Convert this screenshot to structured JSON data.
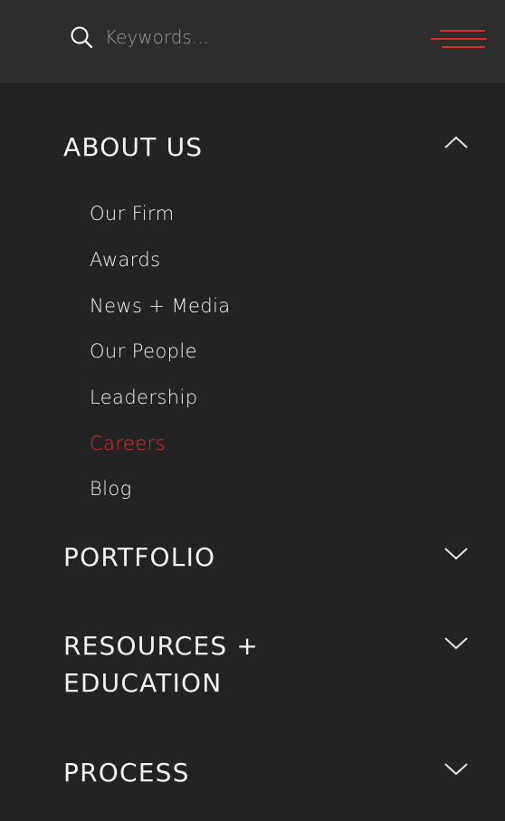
{
  "search": {
    "placeholder": "Keywords...",
    "value": "",
    "icon": "search-icon"
  },
  "menu_toggle": {
    "icon": "hamburger-menu-icon",
    "color": "#d9302b"
  },
  "colors": {
    "background": "#232323",
    "topbar": "#2d2d2d",
    "accent": "#d9302b",
    "text": "#ffffff"
  },
  "nav": {
    "sections": [
      {
        "title": "ABOUT US",
        "expanded": true,
        "chevron_icon": "chevron-up-icon",
        "items": [
          {
            "label": "Our Firm",
            "active": false
          },
          {
            "label": "Awards",
            "active": false
          },
          {
            "label": "News + Media",
            "active": false
          },
          {
            "label": "Our People",
            "active": false
          },
          {
            "label": "Leadership",
            "active": false
          },
          {
            "label": "Careers",
            "active": true
          },
          {
            "label": "Blog",
            "active": false
          }
        ]
      },
      {
        "title": "PORTFOLIO",
        "expanded": false,
        "chevron_icon": "chevron-down-icon"
      },
      {
        "title": "RESOURCES +\nEDUCATION",
        "expanded": false,
        "chevron_icon": "chevron-down-icon"
      },
      {
        "title": "PROCESS",
        "expanded": false,
        "chevron_icon": "chevron-down-icon"
      }
    ]
  }
}
